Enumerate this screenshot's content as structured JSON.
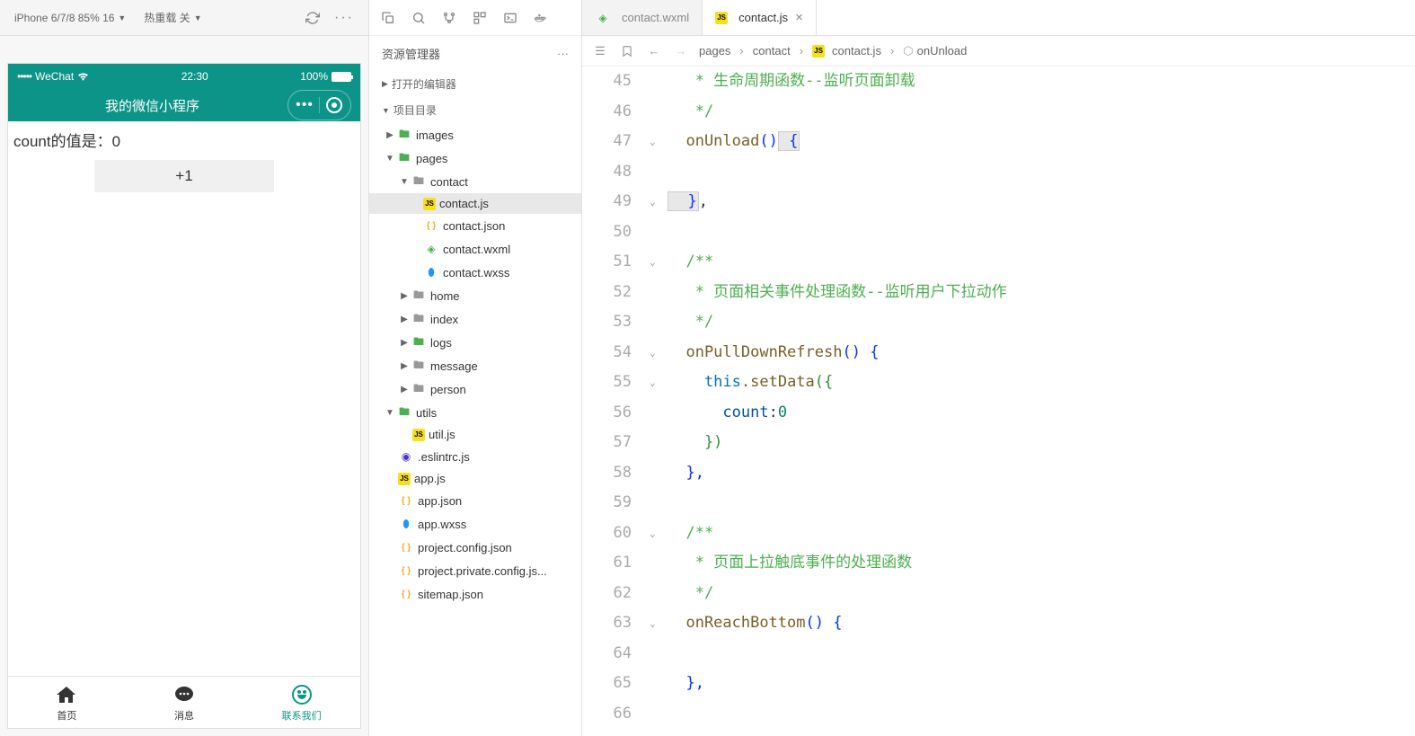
{
  "simulator": {
    "device": "iPhone 6/7/8 85% 16",
    "hot_reload": "热重载 关",
    "status_bar": {
      "carrier": "WeChat",
      "time": "22:30",
      "battery": "100%"
    },
    "nav_title": "我的微信小程序",
    "count_label": "count的值是：",
    "count_value": "0",
    "plus_btn": "+1",
    "tabs": [
      {
        "label": "首页"
      },
      {
        "label": "消息"
      },
      {
        "label": "联系我们"
      }
    ]
  },
  "explorer": {
    "title": "资源管理器",
    "sections": {
      "open_editors": "打开的编辑器",
      "project": "项目目录"
    },
    "tree": {
      "images": "images",
      "pages": "pages",
      "contact": "contact",
      "contact_js": "contact.js",
      "contact_json": "contact.json",
      "contact_wxml": "contact.wxml",
      "contact_wxss": "contact.wxss",
      "home": "home",
      "index": "index",
      "logs": "logs",
      "message": "message",
      "person": "person",
      "utils": "utils",
      "util_js": "util.js",
      "eslintrc": ".eslintrc.js",
      "app_js": "app.js",
      "app_json": "app.json",
      "app_wxss": "app.wxss",
      "project_config": "project.config.json",
      "project_private": "project.private.config.js...",
      "sitemap": "sitemap.json"
    }
  },
  "editor": {
    "tabs": [
      {
        "name": "contact.wxml"
      },
      {
        "name": "contact.js"
      }
    ],
    "breadcrumb": {
      "pages": "pages",
      "contact": "contact",
      "file": "contact.js",
      "symbol": "onUnload"
    },
    "lines": {
      "45": "   * 生命周期函数--监听页面卸载",
      "46": "   */",
      "47a": "  onUnload",
      "47b": "()",
      "47c": " {",
      "49a": "  }",
      "49b": ",",
      "51": "  /**",
      "52": "   * 页面相关事件处理函数--监听用户下拉动作",
      "53": "   */",
      "54a": "  onPullDownRefresh",
      "54b": "()",
      "54c": " {",
      "55a": "    this",
      "55b": ".setData",
      "55c": "({",
      "56a": "      count",
      "56b": ":",
      "56c": "0",
      "57": "    })",
      "58": "  },",
      "60": "  /**",
      "61": "   * 页面上拉触底事件的处理函数",
      "62": "   */",
      "63a": "  onReachBottom",
      "63b": "()",
      "63c": " {",
      "65": "  },"
    }
  }
}
